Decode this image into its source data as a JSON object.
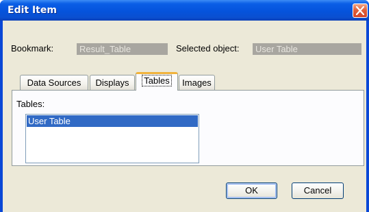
{
  "window": {
    "title": "Edit Item"
  },
  "header": {
    "bookmark_label": "Bookmark:",
    "bookmark_value": "Result_Table",
    "selected_object_label": "Selected object:",
    "selected_object_value": "User Table"
  },
  "tabs": [
    {
      "label": "Data Sources",
      "active": false
    },
    {
      "label": "Displays",
      "active": false
    },
    {
      "label": "Tables",
      "active": true
    },
    {
      "label": "Images",
      "active": false
    }
  ],
  "tables_panel": {
    "list_label": "Tables:",
    "items": [
      "User Table"
    ],
    "selected_item": "User Table"
  },
  "buttons": {
    "ok": "OK",
    "cancel": "Cancel"
  },
  "icons": {
    "close": "close-icon"
  },
  "colors": {
    "titlebar": "#0553dc",
    "selection": "#316ac5",
    "active_tab_highlight": "#f0b23c",
    "dialog_background": "#ece9d8"
  }
}
